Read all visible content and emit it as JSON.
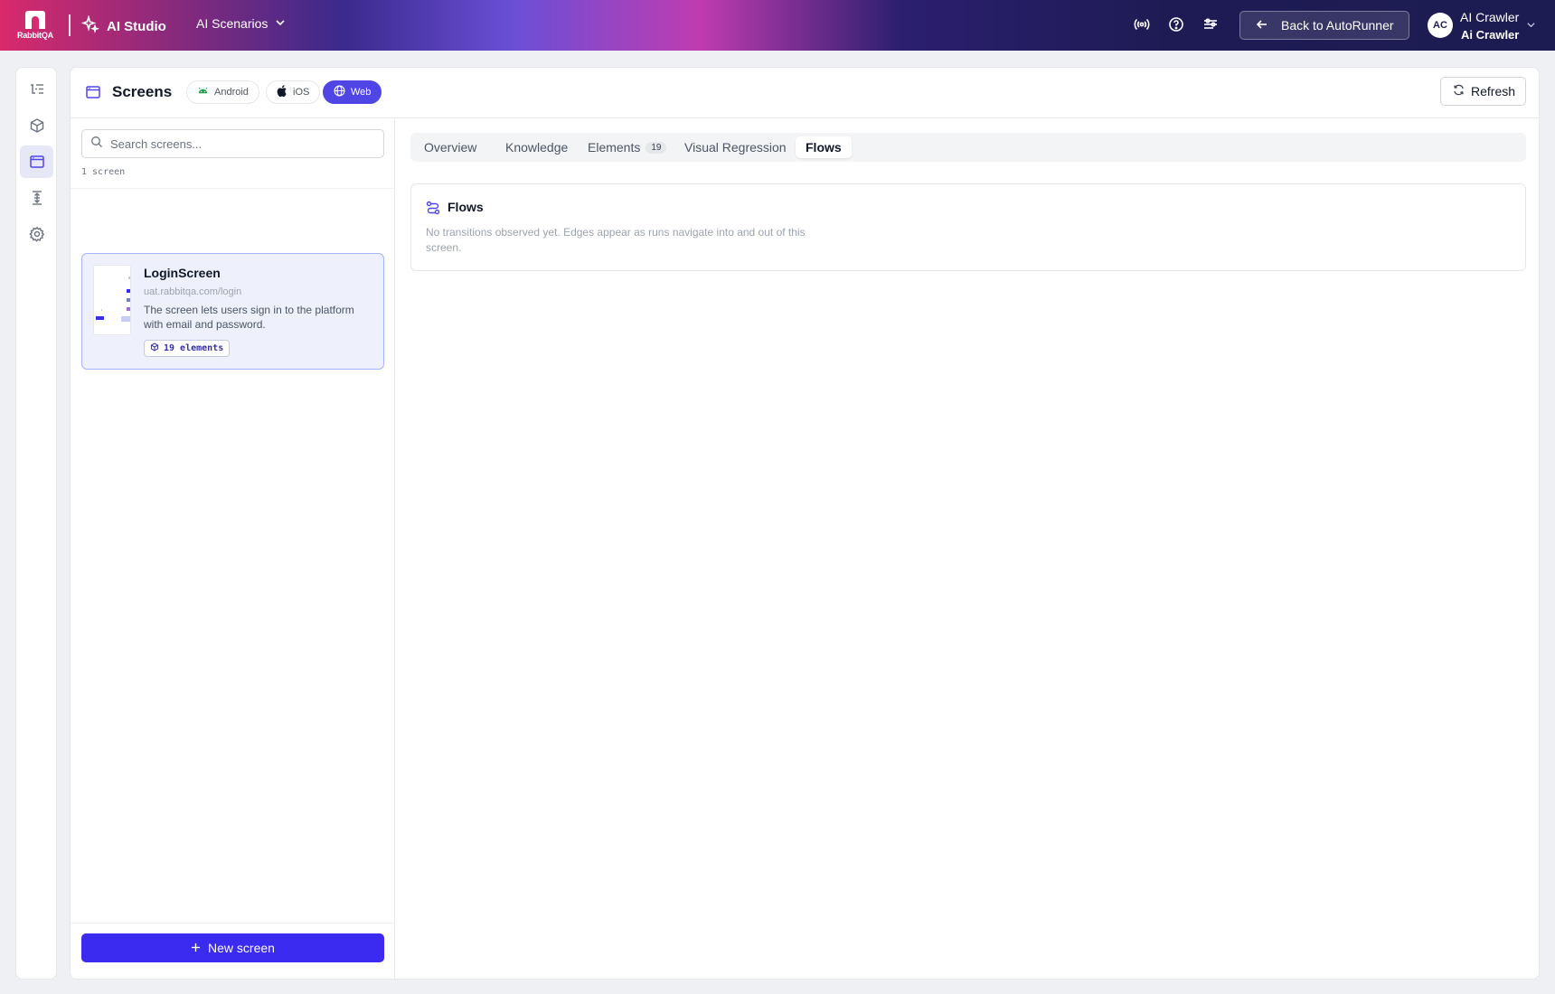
{
  "topbar": {
    "logo_text": "RabbitQA",
    "app_name": "AI Studio",
    "scenario_menu": "AI Scenarios",
    "back_button": "Back to AutoRunner",
    "avatar_initials": "AC",
    "user_name": "AI Crawler",
    "user_subtitle": "Ai Crawler"
  },
  "rail": {
    "items": [
      "scenarios-list-icon",
      "box-icon",
      "screens-icon",
      "align-icon",
      "settings-icon"
    ],
    "active": "screens-icon"
  },
  "header": {
    "title": "Screens",
    "platforms": [
      {
        "label": "Android",
        "icon": "android-icon"
      },
      {
        "label": "iOS",
        "icon": "apple-icon"
      },
      {
        "label": "Web",
        "icon": "globe-icon",
        "active": true
      }
    ],
    "refresh_label": "Refresh"
  },
  "list": {
    "search_placeholder": "Search screens...",
    "count_label": "1 screen",
    "items": [
      {
        "title": "LoginScreen",
        "url": "uat.rabbitqa.com/login",
        "description": "The screen lets users sign in to the platform with email and password.",
        "badge": "19 elements"
      }
    ],
    "new_button": "New screen"
  },
  "detail": {
    "tabs": [
      {
        "label": "Overview"
      },
      {
        "label": "Knowledge"
      },
      {
        "label": "Elements",
        "badge": "19"
      },
      {
        "label": "Visual Regression"
      },
      {
        "label": "Flows",
        "active": true
      }
    ],
    "flows": {
      "title": "Flows",
      "empty_text": "No transitions observed yet. Edges appear as runs navigate into and out of this screen."
    }
  },
  "colors": {
    "accent": "#4f46e5",
    "primary_button": "#3b2bf0",
    "selected_card_bg": "#eef0fc"
  }
}
